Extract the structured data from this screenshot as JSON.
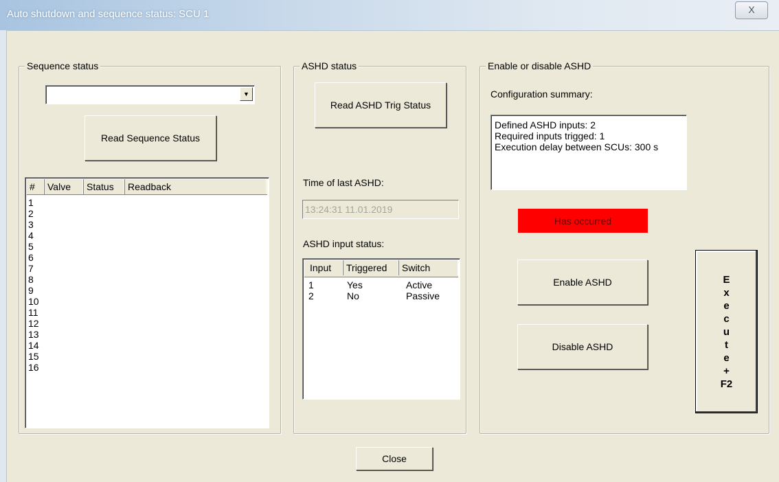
{
  "window": {
    "title": "Auto shutdown and sequence status: SCU 1",
    "close_glyph": "X"
  },
  "sequence": {
    "legend": "Sequence status",
    "combo_value": "",
    "read_button": "Read Sequence Status",
    "columns": [
      "#",
      "Valve",
      "Status",
      "Readback"
    ],
    "rows": [
      "1",
      "2",
      "3",
      "4",
      "5",
      "6",
      "7",
      "8",
      "9",
      "10",
      "11",
      "12",
      "13",
      "14",
      "15",
      "16"
    ]
  },
  "ashd_status": {
    "legend": "ASHD status",
    "read_button": "Read ASHD Trig Status",
    "time_label": "Time of last ASHD:",
    "time_value": "13:24:31 11.01.2019",
    "input_label": "ASHD input status:",
    "columns": [
      "Input",
      "Triggered",
      "Switch"
    ],
    "rows": [
      {
        "input": "1",
        "triggered": "Yes",
        "switch": "Active"
      },
      {
        "input": "2",
        "triggered": "No",
        "switch": "Passive"
      }
    ]
  },
  "enable": {
    "legend": "Enable or disable ASHD",
    "summary_label": "Configuration summary:",
    "summary_lines": [
      "Defined ASHD inputs: 2",
      "Required inputs trigged: 1",
      "Execution delay between SCUs: 300 s"
    ],
    "occurred_text": "Has occurred",
    "occurred_color": "#ff0000",
    "enable_button": "Enable ASHD",
    "disable_button": "Disable ASHD",
    "execute_chars": [
      "E",
      "x",
      "e",
      "c",
      "u",
      "t",
      "e",
      "+",
      "F2"
    ]
  },
  "close_button": "Close"
}
